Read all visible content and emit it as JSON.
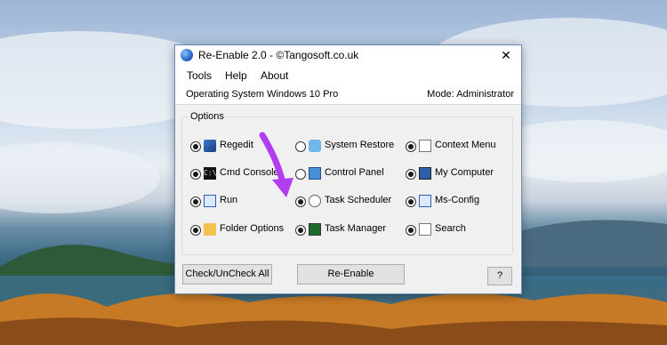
{
  "window": {
    "title": "Re-Enable 2.0  - ©Tangosoft.co.uk",
    "close_glyph": "✕"
  },
  "menu": [
    "Tools",
    "Help",
    "About"
  ],
  "status": {
    "os": "Operating System Windows 10 Pro",
    "mode": "Mode: Administrator"
  },
  "options": {
    "group_label": "Options",
    "items": [
      {
        "label": "Regedit",
        "icon": "registry-icon",
        "checked": true
      },
      {
        "label": "Cmd Console",
        "icon": "console-icon",
        "checked": true
      },
      {
        "label": "Run",
        "icon": "run-icon",
        "checked": true
      },
      {
        "label": "Folder Options",
        "icon": "folder-icon",
        "checked": true
      },
      {
        "label": "System Restore",
        "icon": "restore-icon",
        "checked": false
      },
      {
        "label": "Control Panel",
        "icon": "control-panel-icon",
        "checked": false
      },
      {
        "label": "Task Scheduler",
        "icon": "clock-icon",
        "checked": true
      },
      {
        "label": "Task Manager",
        "icon": "task-manager-icon",
        "checked": true
      },
      {
        "label": "Context Menu",
        "icon": "context-menu-icon",
        "checked": true
      },
      {
        "label": "My Computer",
        "icon": "computer-icon",
        "checked": true
      },
      {
        "label": "Ms-Config",
        "icon": "msconfig-icon",
        "checked": true
      },
      {
        "label": "Search",
        "icon": "search-icon",
        "checked": true
      }
    ]
  },
  "buttons": {
    "check_uncheck": "Check/UnCheck All",
    "reenable": "Re-Enable",
    "help": "?"
  },
  "colors": {
    "annotation_arrow": "#b23cf0",
    "title_border": "#6b8bb5"
  }
}
